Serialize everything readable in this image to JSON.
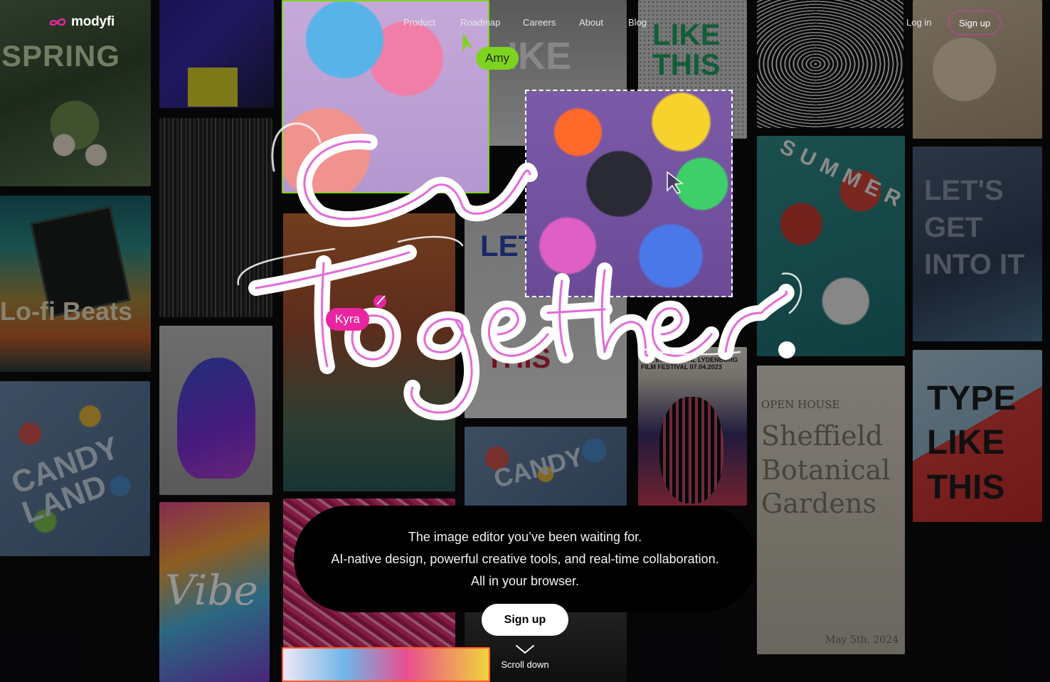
{
  "app": {
    "logo_text": "modyfi",
    "brand_color": "#d13bb0"
  },
  "nav": {
    "links": [
      "Product",
      "Roadmap",
      "Careers",
      "About",
      "Blog"
    ],
    "login": "Log in",
    "signup": "Sign up"
  },
  "headline": {
    "line1": "Create",
    "line2": "Together."
  },
  "collaborators": {
    "amy": {
      "name": "Amy",
      "color": "#7ed321"
    },
    "kyra": {
      "name": "Kyra",
      "color": "#e8259f"
    }
  },
  "hero": {
    "line1": "The image editor you’ve been waiting for.",
    "line2": "AI-native design, powerful creative tools, and real-time collaboration.",
    "line3": "All in your browser.",
    "cta": "Sign up",
    "scroll": "Scroll down"
  },
  "tiles": {
    "spring": "SPRING",
    "lofi": "Lo-fi Beats",
    "candy1": "CANDY LAND",
    "vibe": "Vibe",
    "candy2": "CANDY",
    "letget": "LET GET",
    "letget_red": "THIS",
    "top_photo": "IKE",
    "like_this": "LIKE THIS",
    "film": "THE 6TH ANNUAL LYDENBURG FILM FESTIVAL 07.04.2023",
    "summer": "SUMMER",
    "shef_small": "OPEN HOUSE",
    "shef_big": "Sheffield Botanical Gardens",
    "shef_date": "May 5th, 2024",
    "lets": "LET'S GET INTO IT",
    "type": "TYPE LIKE THIS"
  }
}
